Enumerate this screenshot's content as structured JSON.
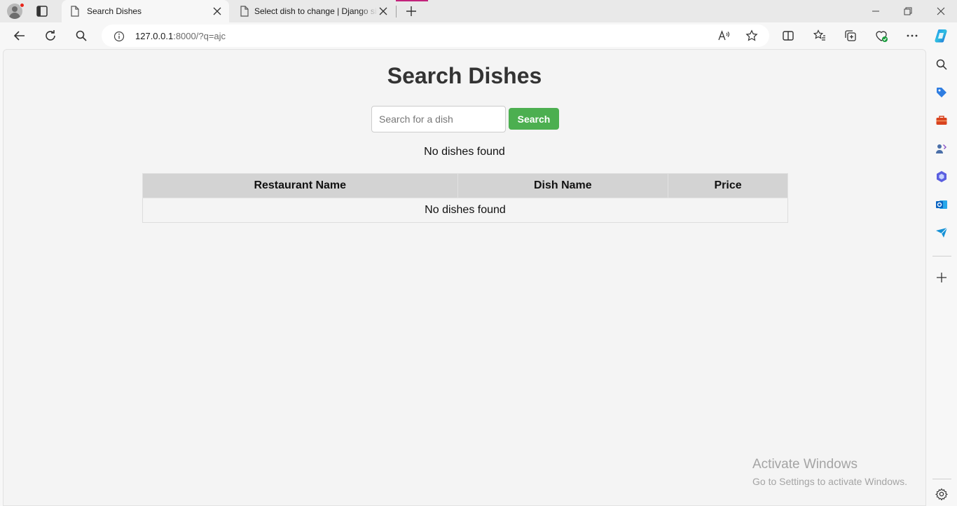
{
  "browser": {
    "tabs": [
      {
        "title": "Search Dishes",
        "active": true
      },
      {
        "title": "Select dish to change | Django site admin",
        "active": false
      }
    ],
    "address": {
      "host": "127.0.0.1",
      "rest": ":8000/?q=ajc"
    }
  },
  "page": {
    "title": "Search Dishes",
    "search": {
      "placeholder": "Search for a dish",
      "value": "",
      "button_label": "Search"
    },
    "message": "No dishes found",
    "table": {
      "headers": [
        "Restaurant Name",
        "Dish Name",
        "Price"
      ],
      "empty_message": "No dishes found"
    }
  },
  "watermark": {
    "line1": "Activate Windows",
    "line2": "Go to Settings to activate Windows."
  },
  "colors": {
    "accent": "#4caf50",
    "header_bg": "#d3d3d3",
    "page_bg": "#f4f4f4"
  }
}
